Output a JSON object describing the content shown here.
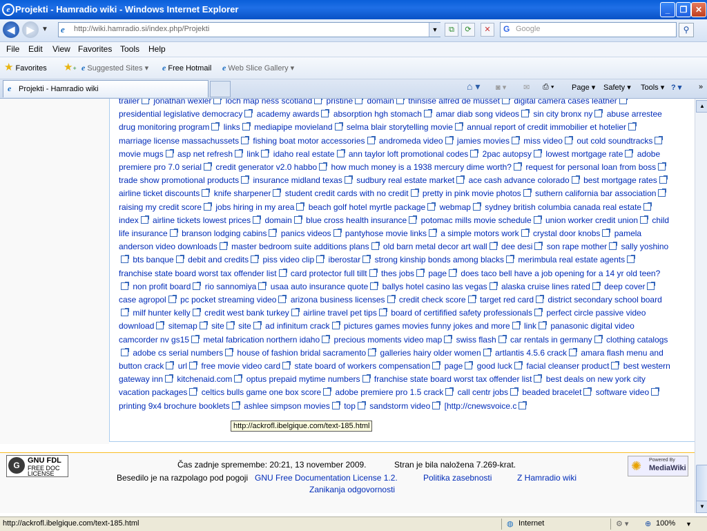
{
  "window": {
    "title": "Projekti - Hamradio wiki - Windows Internet Explorer"
  },
  "nav": {
    "address": "http://wiki.hamradio.si/index.php/Projekti",
    "search_placeholder": "Google"
  },
  "menu": [
    "File",
    "Edit",
    "View",
    "Favorites",
    "Tools",
    "Help"
  ],
  "favbar": {
    "favorites": "Favorites",
    "suggested": "Suggested Sites",
    "hotmail": "Free Hotmail",
    "webslice": "Web Slice Gallery"
  },
  "tab": {
    "label": "Projekti - Hamradio wiki"
  },
  "toolbar": {
    "page": "Page",
    "safety": "Safety",
    "tools": "Tools"
  },
  "content": {
    "links": [
      "trailer",
      "jonathan wexler",
      "loch map ness scotland",
      "pristine",
      "domain",
      "thinsise alfred de musset",
      "digital camera cases leather",
      "presidential legislative democracy",
      "academy awards",
      "absorption hgh stomach",
      "amar diab song videos",
      "sin city bronx ny",
      "abuse arrestee drug monitoring program",
      "links",
      "mediapipe movieland",
      "selma blair storytelling movie",
      "annual report of credit immobilier et hotelier",
      "marriage license massachussets",
      "fishing boat motor accessories",
      "andromeda video",
      "jamies movies",
      "miss video",
      "out cold soundtracks",
      "movie mugs",
      "asp net refresh",
      "link",
      "idaho real estate",
      "ann taylor loft promotional codes",
      "2pac autopsy",
      "lowest mortgage rate",
      "adobe premiere pro 7.0 serial",
      "credit generator v2.0 habbo",
      "how much money is a 1938 mercury dime worth?",
      "request for personal loan from boss",
      "trade show promotional products",
      "insurance midland texas",
      "sudbury real estate market",
      "ace cash advance colorado",
      "best mortgage rates",
      "airline ticket discounts",
      "knife sharpener",
      "student credit cards with no credit",
      "pretty in pink movie photos",
      "suthern california bar association",
      "raising my credit score",
      "jobs hiring in my area",
      "beach golf hotel myrtle package",
      "webmap",
      "sydney british columbia canada real estate",
      "index",
      "airline tickets lowest prices",
      "domain",
      "blue cross health insurance",
      "potomac mills movie schedule",
      "union worker credit union",
      "child life insurance",
      "branson lodging cabins",
      "panics videos",
      "pantyhose movie links",
      "a simple motors work",
      "crystal door knobs",
      "pamela anderson video downloads",
      "master bedroom suite additions plans",
      "old barn metal decor art wall",
      "dee desi",
      "son rape mother",
      "sally yoshino",
      "bts banque",
      "debit and credits",
      "piss video clip",
      "iberostar",
      "strong kinship bonds among blacks",
      "merimbula real estate agents",
      "franchise state board worst tax offender list",
      "card protector full tillt",
      "thes jobs",
      "page",
      "does taco bell have a job opening for a 14 yr old teen?",
      "non profit board",
      "rio sannomiya",
      "usaa auto insurance quote",
      "ballys hotel casino las vegas",
      "alaska cruise lines rated",
      "deep cover",
      "case agropol",
      "pc pocket streaming video",
      "arizona business licenses",
      "credit check score",
      "target red card",
      "district secondary school board",
      "milf hunter kelly",
      "credit west bank turkey",
      "airline travel pet tips",
      "board of certifified safety professionals",
      "perfect circle passive video download",
      "sitemap",
      "site",
      "site",
      "ad infinitum crack",
      "pictures games movies funny jokes and more",
      "link",
      "panasonic digital video camcorder nv gs15",
      "metal fabrication northern idaho",
      "precious moments video map",
      "swiss flash",
      "car rentals in germany",
      "clothing catalogs",
      "adobe cs serial numbers",
      "house of fashion bridal sacramento",
      "galleries hairy older women",
      "artlantis 4.5.6 crack",
      "amara flash menu and button crack",
      "url",
      "free movie video card",
      "state board of workers compensation",
      "page",
      "good luck",
      "facial cleanser product",
      "best western gateway inn",
      "kitchenaid.com",
      "optus prepaid mytime numbers",
      "franchise state board worst tax offender list",
      "best deals on new york city vacation packages",
      "celtics bulls game one box score",
      "adobe premiere pro 1.5 crack",
      "call centr jobs",
      "beaded bracelet",
      "software video",
      "printing 9x4 brochure booklets",
      "ashlee simpson movies",
      "top",
      "sandstorm video"
    ],
    "hovered_index": 143,
    "trailing_text": "[http://cnewsvoice.c",
    "tooltip": "http://ackrofl.ibelgique.com/text-185.html"
  },
  "footer": {
    "gnu": {
      "line1": "GNU FDL",
      "line2": "FREE DOC",
      "line3": "LICENSE"
    },
    "last_modified": "Čas zadnje spremembe: 20:21, 13 november 2009.",
    "views": "Stran je bila naložena 7.269-krat.",
    "license_text": "Besedilo je na razpolago pod pogoji",
    "license_link": "GNU Free Documentation License 1.2.",
    "privacy": "Politika zasebnosti",
    "about": "Z Hamradio wiki",
    "disclaimer": "Zanikanja odgovornosti",
    "mw_powered": "Powered By",
    "mw_name": "MediaWiki"
  },
  "status": {
    "url": "http://ackrofl.ibelgique.com/text-185.html",
    "zone": "Internet",
    "zoom": "100%"
  }
}
